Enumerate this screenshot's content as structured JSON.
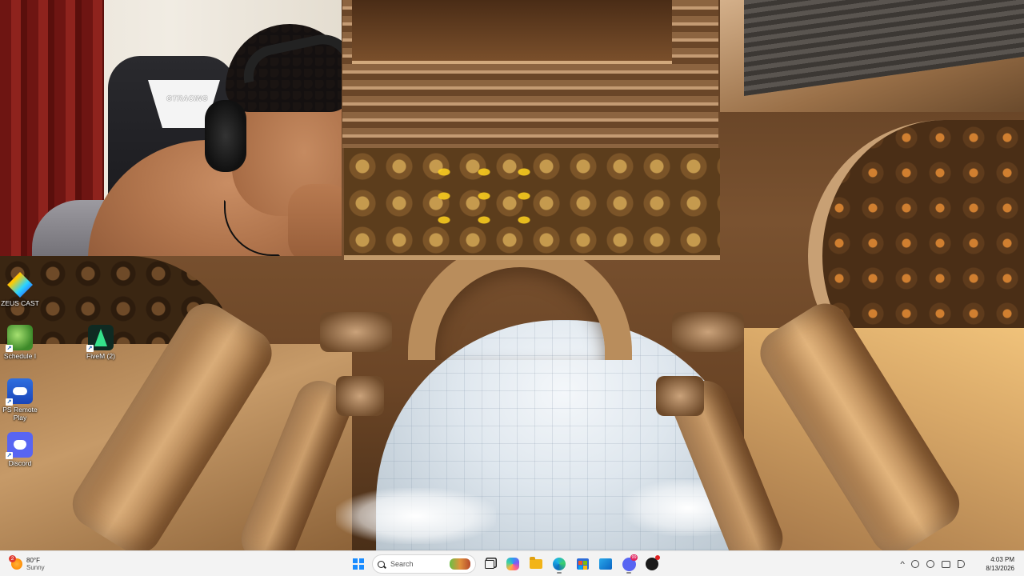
{
  "desktop": {
    "icons": [
      {
        "label": "ZEUS CAST",
        "icon": "zeus-cast-icon"
      },
      {
        "label": "Schedule I",
        "icon": "schedule-one-icon"
      },
      {
        "label": "FiveM (2)",
        "icon": "fivem-icon"
      },
      {
        "label": "PS Remote Play",
        "icon": "ps-remote-play-icon"
      },
      {
        "label": "Discord",
        "icon": "discord-icon"
      }
    ],
    "webcam_chair_logo": "GTRACING"
  },
  "taskbar": {
    "weather": {
      "temp": "80°F",
      "condition": "Sunny",
      "badge": "2"
    },
    "search_placeholder": "Search",
    "apps": [
      {
        "name": "start-button",
        "icon": "windows-logo-icon"
      },
      {
        "name": "task-view",
        "icon": "task-view-icon"
      },
      {
        "name": "copilot",
        "icon": "copilot-icon"
      },
      {
        "name": "file-explorer",
        "icon": "folder-icon"
      },
      {
        "name": "edge",
        "icon": "edge-icon"
      },
      {
        "name": "store",
        "icon": "store-icon"
      },
      {
        "name": "outlook",
        "icon": "outlook-icon"
      },
      {
        "name": "discord",
        "icon": "discord-icon",
        "badge": "99"
      },
      {
        "name": "chatgpt",
        "icon": "chatgpt-icon"
      }
    ],
    "clock": {
      "time": "4:03 PM",
      "date": "8/13/2026"
    }
  },
  "colors": {
    "taskbar_bg": "#f3f3f3",
    "accent": "#1a8cff"
  }
}
